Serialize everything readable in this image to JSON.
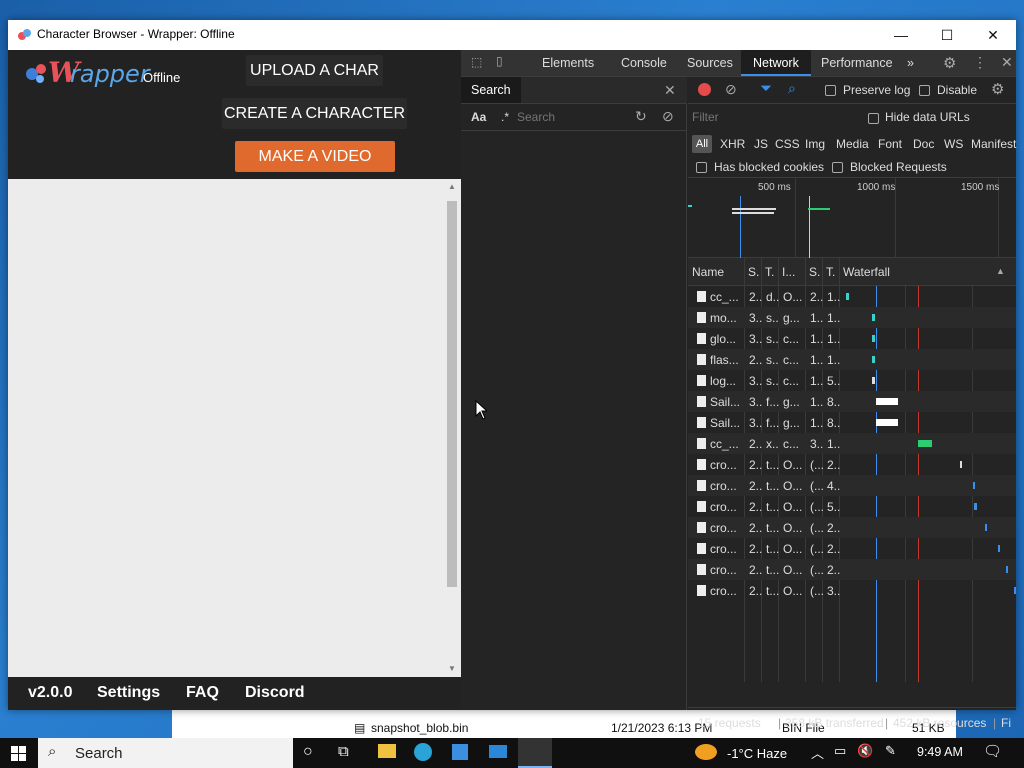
{
  "window": {
    "title": "Character Browser - Wrapper: Offline",
    "minimize": "—",
    "maximize": "☐",
    "close": "✕"
  },
  "app": {
    "logo_w": "W",
    "logo_rest": "rapper",
    "logo_offline": "Offline",
    "upload_label": "UPLOAD A CHAR",
    "create_label": "CREATE A CHARACTER",
    "video_label": "MAKE A VIDEO",
    "footer": {
      "version": "v2.0.0",
      "settings": "Settings",
      "faq": "FAQ",
      "discord": "Discord"
    }
  },
  "devtools": {
    "tabs": [
      "Elements",
      "Console",
      "Sources",
      "Network",
      "Performance"
    ],
    "active_tab": "Network",
    "more": "»",
    "search": {
      "tab_label": "Search",
      "case_label": "Aa",
      "regex_label": ".*",
      "placeholder": "Search"
    },
    "network": {
      "preserve_log": "Preserve log",
      "disable_cache": "Disable",
      "filter_placeholder": "Filter",
      "hide_data_urls": "Hide data URLs",
      "types": [
        "All",
        "XHR",
        "JS",
        "CSS",
        "Img",
        "Media",
        "Font",
        "Doc",
        "WS",
        "Manifest"
      ],
      "has_blocked_cookies": "Has blocked cookies",
      "blocked_requests": "Blocked Requests",
      "ticks": [
        "500 ms",
        "1000 ms",
        "1500 ms"
      ],
      "columns": [
        "Name",
        "S.",
        "T.",
        "I...",
        "S.",
        "T.",
        "Waterfall"
      ],
      "rows": [
        [
          "cc_...",
          "2..",
          "d..",
          "O...",
          "2..",
          "1.."
        ],
        [
          "mo...",
          "3..",
          "s..",
          "g...",
          "1..",
          "1.."
        ],
        [
          "glo...",
          "3..",
          "s..",
          "c...",
          "1..",
          "1.."
        ],
        [
          "flas...",
          "2..",
          "s..",
          "c...",
          "1..",
          "1.."
        ],
        [
          "log...",
          "3..",
          "s..",
          "c...",
          "1..",
          "5.."
        ],
        [
          "Sail...",
          "3..",
          "f...",
          "g...",
          "1..",
          "8.."
        ],
        [
          "Sail...",
          "3..",
          "f...",
          "g...",
          "1..",
          "8.."
        ],
        [
          "cc_...",
          "2..",
          "x..",
          "c...",
          "3..",
          "1.."
        ],
        [
          "cro...",
          "2..",
          "t...",
          "O...",
          "(...",
          "2.."
        ],
        [
          "cro...",
          "2..",
          "t...",
          "O...",
          "(...",
          "4.."
        ],
        [
          "cro...",
          "2..",
          "t...",
          "O...",
          "(...",
          "5.."
        ],
        [
          "cro...",
          "2..",
          "t...",
          "O...",
          "(...",
          "2.."
        ],
        [
          "cro...",
          "2..",
          "t...",
          "O...",
          "(...",
          "2.."
        ],
        [
          "cro...",
          "2..",
          "t...",
          "O...",
          "(...",
          "2.."
        ],
        [
          "cro...",
          "2..",
          "t...",
          "O...",
          "(...",
          "3.."
        ]
      ],
      "status": {
        "requests": "15 requests",
        "transferred": "358 kB transferred",
        "resources": "452 kB resources",
        "finish": "Fi"
      }
    }
  },
  "explorer_row": {
    "name": "snapshot_blob.bin",
    "date": "1/21/2023 6:13 PM",
    "type": "BIN File",
    "size": "51 KB"
  },
  "taskbar": {
    "search": "Search",
    "weather": "-1°C  Haze",
    "time": "9:49 AM"
  }
}
